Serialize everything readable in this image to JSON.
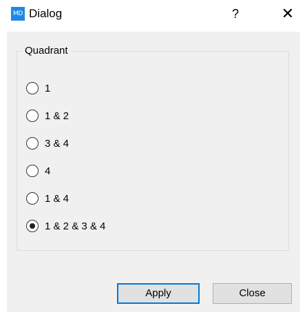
{
  "window": {
    "title": "Dialog",
    "icon_label": "MD",
    "help_label": "?",
    "close_label": "✕"
  },
  "group": {
    "title": "Quadrant"
  },
  "radios": [
    {
      "label": "1",
      "checked": false
    },
    {
      "label": "1 & 2",
      "checked": false
    },
    {
      "label": "3 & 4",
      "checked": false
    },
    {
      "label": "4",
      "checked": false
    },
    {
      "label": "1 & 4",
      "checked": false
    },
    {
      "label": "1 & 2 & 3 & 4",
      "checked": true
    }
  ],
  "buttons": {
    "apply_label": "Apply",
    "close_label": "Close"
  }
}
